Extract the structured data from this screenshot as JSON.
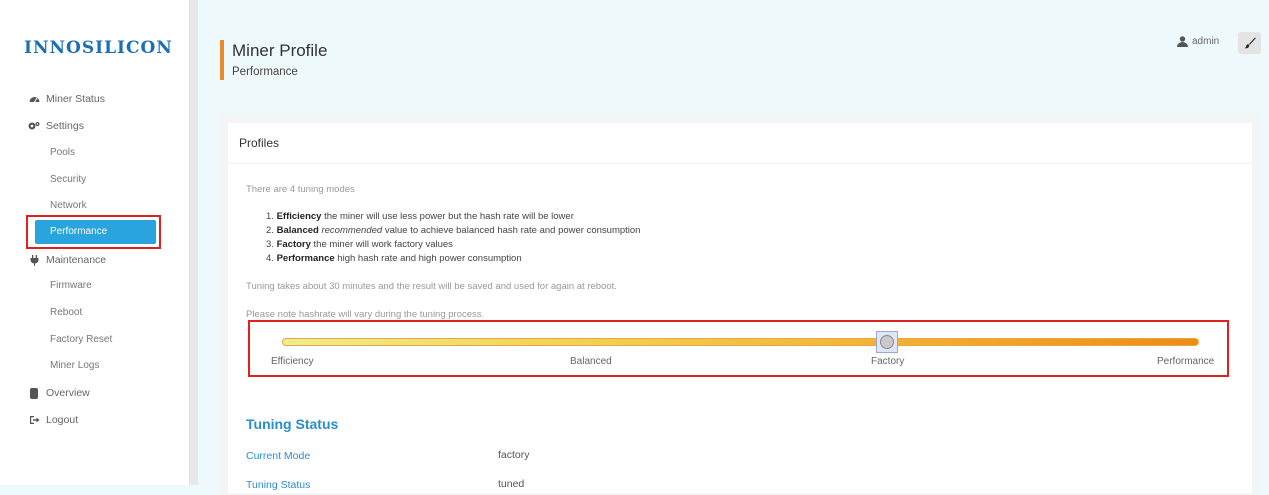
{
  "brand": {
    "logo": "INNOSILICON"
  },
  "sidebar": {
    "items": [
      {
        "label": "Miner Status",
        "icon": "dashboard-icon"
      },
      {
        "label": "Settings",
        "icon": "gears-icon"
      },
      {
        "label": "Maintenance",
        "icon": "plug-icon"
      },
      {
        "label": "Overview",
        "icon": "database-icon"
      },
      {
        "label": "Logout",
        "icon": "logout-icon"
      }
    ],
    "settings_sub": [
      "Pools",
      "Security",
      "Network",
      "Performance"
    ],
    "maintenance_sub": [
      "Firmware",
      "Reboot",
      "Factory Reset",
      "Miner Logs"
    ],
    "active": "Performance"
  },
  "header": {
    "title": "Miner Profile",
    "subtitle": "Performance",
    "user": "admin"
  },
  "profiles": {
    "title": "Profiles",
    "intro": "There are 4 tuning modes",
    "modes": [
      {
        "num": "1.",
        "name": "Efficiency",
        "desc": " the miner will use less power but the hash rate will be lower"
      },
      {
        "num": "2.",
        "name": "Balanced",
        "emph": "recommended",
        "desc": " value to achieve balanced hash rate and power consumption"
      },
      {
        "num": "3.",
        "name": "Factory",
        "desc": " the miner will work factory values"
      },
      {
        "num": "4.",
        "name": "Performance",
        "desc": " high hash rate and high power consumption"
      }
    ],
    "note1": "Tuning takes about 30 minutes and the result will be saved and used for again at reboot.",
    "note2": "Please note hashrate will vary during the tuning process.",
    "slider": {
      "labels": [
        "Efficiency",
        "Balanced",
        "Factory",
        "Performance"
      ],
      "selected": "Factory",
      "value_fraction": 0.66
    }
  },
  "tuning_status": {
    "title": "Tuning Status",
    "rows": [
      {
        "key": "Current Mode",
        "value": "factory"
      },
      {
        "key": "Tuning Status",
        "value": "tuned"
      }
    ]
  },
  "colors": {
    "accent": "#2aa4dc",
    "highlight": "#e32020",
    "header_bar": "#e98a2a"
  }
}
